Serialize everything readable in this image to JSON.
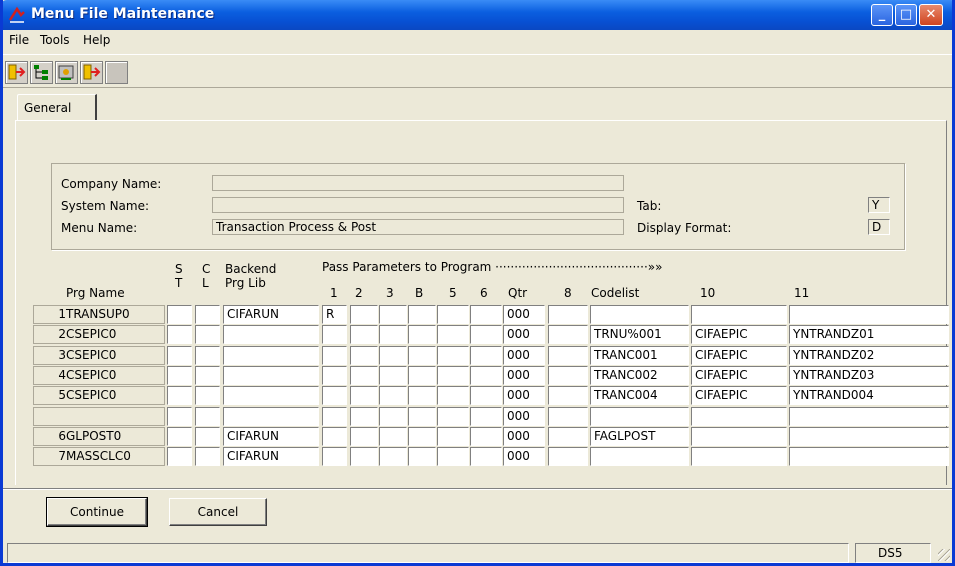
{
  "window": {
    "title": "Menu File Maintenance",
    "min": "_",
    "max": "□",
    "close": "✕"
  },
  "menu": [
    "File",
    "Tools",
    "Help"
  ],
  "toolbar": {
    "icons": [
      "exit-icon",
      "tree-icon",
      "settings-icon",
      "logout-icon",
      "blank-icon"
    ]
  },
  "tab": {
    "label": "General"
  },
  "info": {
    "company_label": "Company Name:",
    "company_value": "",
    "system_label": "System Name:",
    "system_value": "",
    "menu_label": "Menu Name:",
    "menu_value": "Transaction Process & Post",
    "tab_label": "Tab:",
    "tab_value": "Y",
    "format_label": "Display Format:",
    "format_value": "D"
  },
  "headers": {
    "prg_name": "Prg Name",
    "s_top": "S",
    "s_bottom": "T",
    "c_top": "C",
    "c_bottom": "L",
    "backend_top": "Backend",
    "backend_bottom": "Prg Lib",
    "pass_params": "Pass Parameters to Program ········································»»",
    "p1": "1",
    "p2": "2",
    "p3": "3",
    "p4": "B",
    "p5": "5",
    "p6": "6",
    "p7": "Qtr",
    "p8": "8",
    "p9": "Codelist",
    "p10": "10",
    "p11": "11"
  },
  "rows": [
    {
      "num": "1",
      "name": "TRANSUP0",
      "st": "",
      "cl": "",
      "lib": "CIFARUN",
      "p1": "R",
      "p2": "",
      "p3": "",
      "p4": "",
      "p5": "",
      "p6": "",
      "p7": "000",
      "p8": "",
      "p9": "",
      "p10": "",
      "p11": ""
    },
    {
      "num": "2",
      "name": "CSEPIC0",
      "st": "",
      "cl": "",
      "lib": "",
      "p1": "",
      "p2": "",
      "p3": "",
      "p4": "",
      "p5": "",
      "p6": "",
      "p7": "000",
      "p8": "",
      "p9": "TRNU%001",
      "p10": "CIFAEPIC",
      "p11": "YNTRANDZ01"
    },
    {
      "num": "3",
      "name": "CSEPIC0",
      "st": "",
      "cl": "",
      "lib": "",
      "p1": "",
      "p2": "",
      "p3": "",
      "p4": "",
      "p5": "",
      "p6": "",
      "p7": "000",
      "p8": "",
      "p9": "TRANC001",
      "p10": "CIFAEPIC",
      "p11": "YNTRANDZ02"
    },
    {
      "num": "4",
      "name": "CSEPIC0",
      "st": "",
      "cl": "",
      "lib": "",
      "p1": "",
      "p2": "",
      "p3": "",
      "p4": "",
      "p5": "",
      "p6": "",
      "p7": "000",
      "p8": "",
      "p9": "TRANC002",
      "p10": "CIFAEPIC",
      "p11": "YNTRANDZ03"
    },
    {
      "num": "5",
      "name": "CSEPIC0",
      "st": "",
      "cl": "",
      "lib": "",
      "p1": "",
      "p2": "",
      "p3": "",
      "p4": "",
      "p5": "",
      "p6": "",
      "p7": "000",
      "p8": "",
      "p9": "TRANC004",
      "p10": "CIFAEPIC",
      "p11": "YNTRAND004"
    },
    {
      "num": "",
      "name": "",
      "st": "",
      "cl": "",
      "lib": "",
      "p1": "",
      "p2": "",
      "p3": "",
      "p4": "",
      "p5": "",
      "p6": "",
      "p7": "000",
      "p8": "",
      "p9": "",
      "p10": "",
      "p11": ""
    },
    {
      "num": "6",
      "name": "GLPOST0",
      "st": "",
      "cl": "",
      "lib": "CIFARUN",
      "p1": "",
      "p2": "",
      "p3": "",
      "p4": "",
      "p5": "",
      "p6": "",
      "p7": "000",
      "p8": "",
      "p9": "FAGLPOST",
      "p10": "",
      "p11": ""
    },
    {
      "num": "7",
      "name": "MASSCLC0",
      "st": "",
      "cl": "",
      "lib": "CIFARUN",
      "p1": "",
      "p2": "",
      "p3": "",
      "p4": "",
      "p5": "",
      "p6": "",
      "p7": "000",
      "p8": "",
      "p9": "",
      "p10": "",
      "p11": ""
    }
  ],
  "buttons": {
    "continue": "Continue",
    "cancel": "Cancel"
  },
  "status": {
    "left": "",
    "right": "DS5"
  }
}
